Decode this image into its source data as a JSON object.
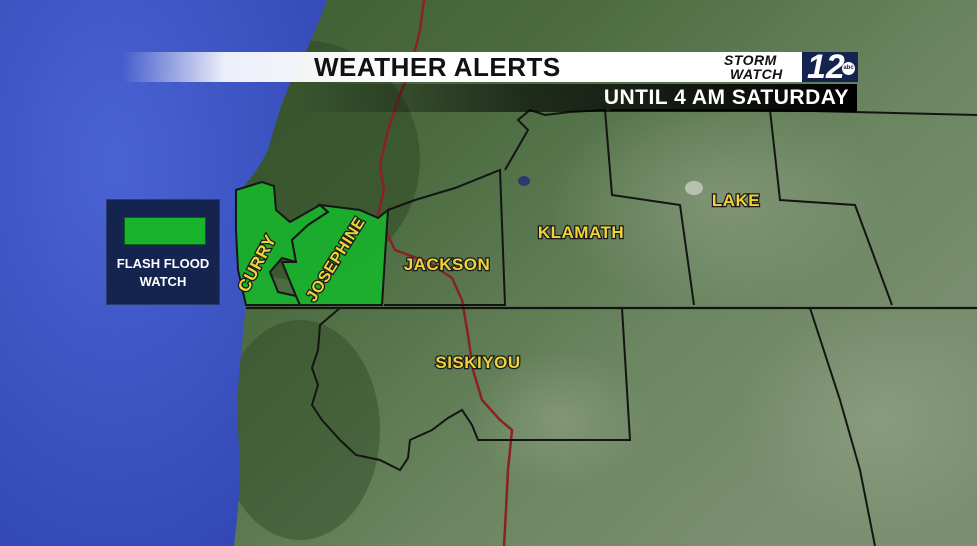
{
  "header": {
    "title": "WEATHER ALERTS",
    "subtitle": "UNTIL 4 AM SATURDAY"
  },
  "logo": {
    "line1": "STORM",
    "line2": "WATCH",
    "number": "12",
    "network": "abc",
    "box_color": "#14244f"
  },
  "legend": {
    "label_line1": "FLASH FLOOD",
    "label_line2": "WATCH",
    "swatch_color": "#19b32d"
  },
  "counties": {
    "curry": "CURRY",
    "josephine": "JOSEPHINE",
    "jackson": "JACKSON",
    "klamath": "KLAMATH",
    "lake": "LAKE",
    "siskiyou": "SISKIYOU"
  },
  "colors": {
    "ocean": "#3d55c8",
    "land": "#4a6a3c",
    "alert_fill": "#19b32d",
    "label": "#f1d23a",
    "highway": "#8a2222"
  }
}
